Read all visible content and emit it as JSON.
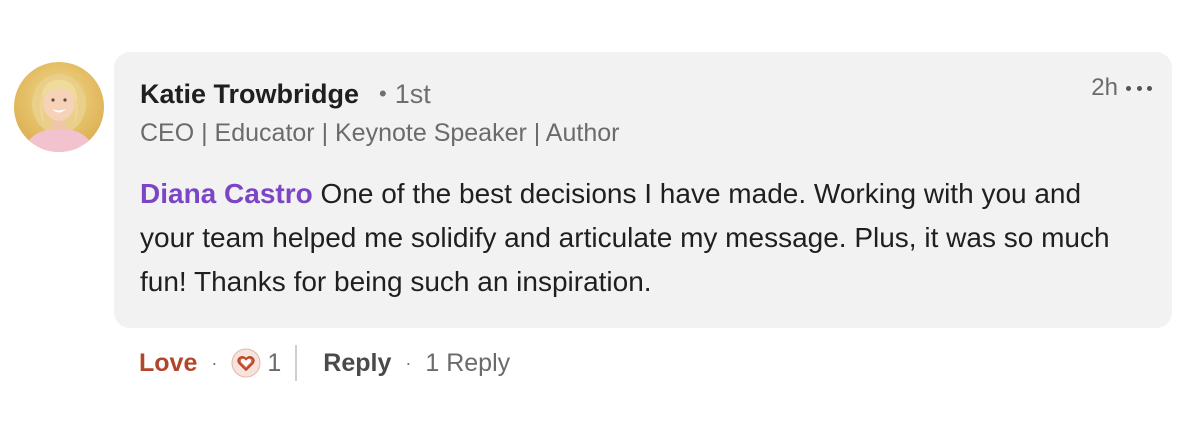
{
  "comment": {
    "author": {
      "name": "Katie Trowbridge",
      "degree": "1st",
      "separator": "•",
      "headline": "CEO | Educator | Keynote Speaker | Author",
      "avatar_icon": "profile-photo"
    },
    "timestamp": "2h",
    "more_icon": "ellipsis-icon",
    "mention": "Diana Castro",
    "text": " One of the best decisions I have made. Working with you and your team helped me solidify and articulate my message. Plus, it was so much fun! Thanks for being such an inspiration."
  },
  "actions": {
    "love_label": "Love",
    "separator": "·",
    "reaction_icon": "love-heart-icon",
    "reaction_count": "1",
    "reply_label": "Reply",
    "replies_label": "1 Reply"
  },
  "colors": {
    "bubble_bg": "#f2f2f2",
    "mention": "#7b45c6",
    "love": "#b2462a",
    "heart_fill": "#e06847"
  }
}
